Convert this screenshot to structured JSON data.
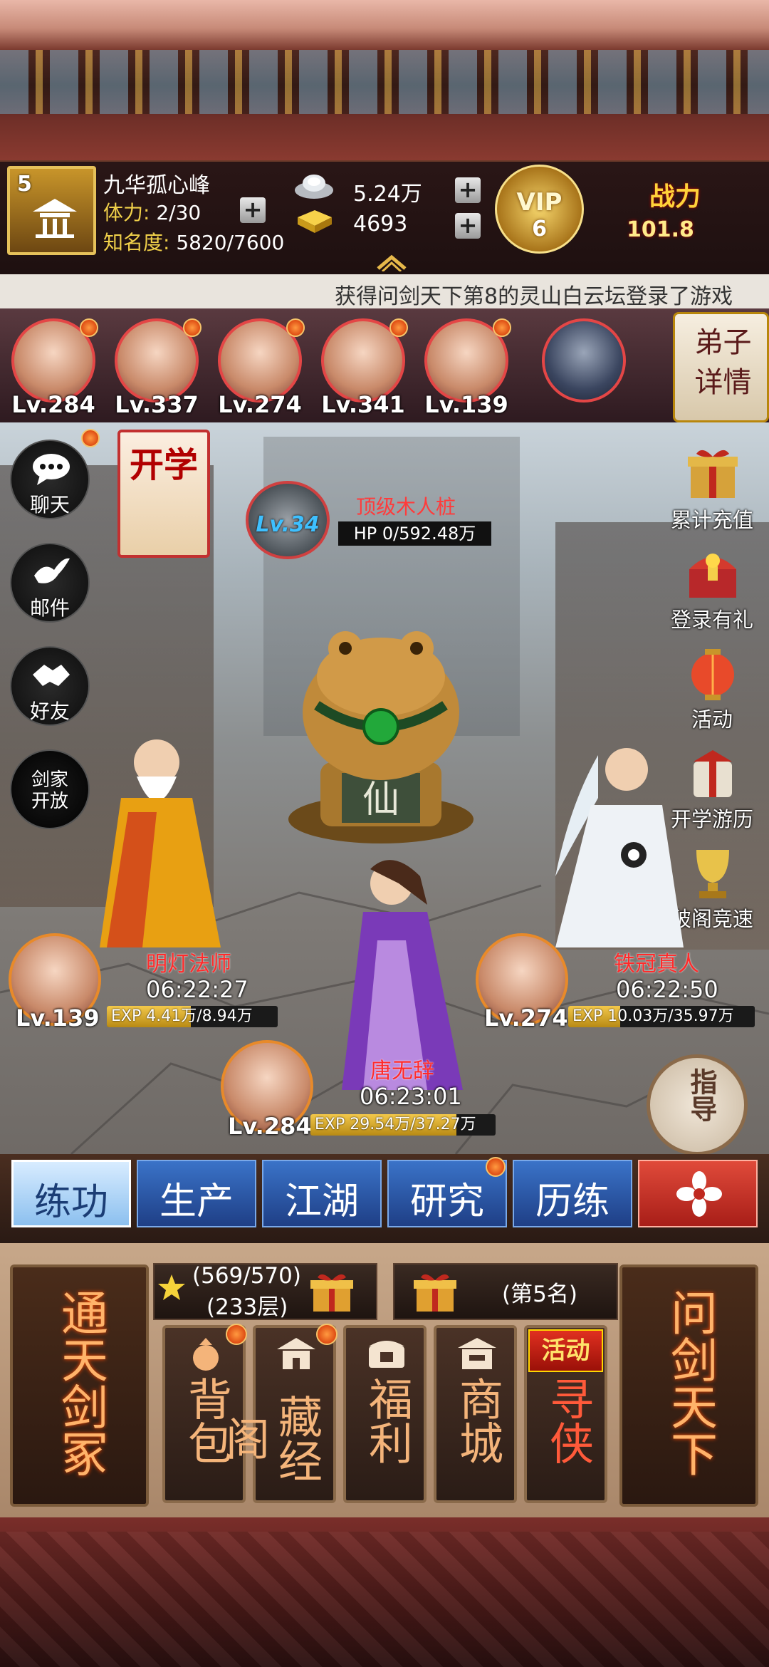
{
  "player": {
    "sect_level": "5",
    "name": "九华孤心峰",
    "stamina_label": "体力:",
    "stamina_value": "2/30",
    "fame_label": "知名度:",
    "fame_value": "5820/7600",
    "silver": "5.24万",
    "gold": "4693",
    "vip_label": "VIP",
    "vip_level": "6",
    "power_label": "战力",
    "power_value": "101.8"
  },
  "ticker": "获得问剑天下第8的灵山白云坛登录了游戏",
  "disciples": [
    {
      "lv": "Lv.284",
      "dot": true
    },
    {
      "lv": "Lv.337",
      "dot": true
    },
    {
      "lv": "Lv.274",
      "dot": true
    },
    {
      "lv": "Lv.341",
      "dot": true
    },
    {
      "lv": "Lv.139",
      "dot": true
    }
  ],
  "disciple_detail": "弟子详情",
  "left_menu": {
    "chat": "聊天",
    "mail": "邮件",
    "friends": "好友",
    "sword_open": "剑家开放"
  },
  "scroll_banner": "开学",
  "boss": {
    "lv": "Lv.34",
    "name": "顶级木人桩",
    "hp": "HP 0/592.48万"
  },
  "toad_plate": "仙",
  "right_menu": {
    "recharge": "累计充值",
    "login_gift": "登录有礼",
    "activity": "活动",
    "school_tour": "开学游历",
    "pavilion_race": "破阁竞速"
  },
  "units": {
    "left": {
      "lv": "Lv.139",
      "name": "明灯法师",
      "time": "06:22:27",
      "exp": "EXP 4.41万/8.94万",
      "exp_ratio": 0.49
    },
    "right": {
      "lv": "Lv.274",
      "name": "铁冠真人",
      "time": "06:22:50",
      "exp": "EXP 10.03万/35.97万",
      "exp_ratio": 0.28
    },
    "center": {
      "lv": "Lv.284",
      "name": "唐无辞",
      "time": "06:23:01",
      "exp": "EXP 29.54万/37.27万",
      "exp_ratio": 0.79
    }
  },
  "guide": "指导",
  "tabs": {
    "train": "练功",
    "produce": "生产",
    "jianghu": "江湖",
    "research": "研究",
    "experience": "历练"
  },
  "bottom": {
    "left_big": "通天剑冢",
    "right_big": "问剑天下",
    "stars": "(569/570)",
    "floors": "(233层)",
    "rank": "(第5名)",
    "bag": "背包",
    "library": "藏经阁",
    "welfare": "福利",
    "shop": "商城",
    "activity_tag": "活动",
    "seek_hero": "寻侠"
  }
}
